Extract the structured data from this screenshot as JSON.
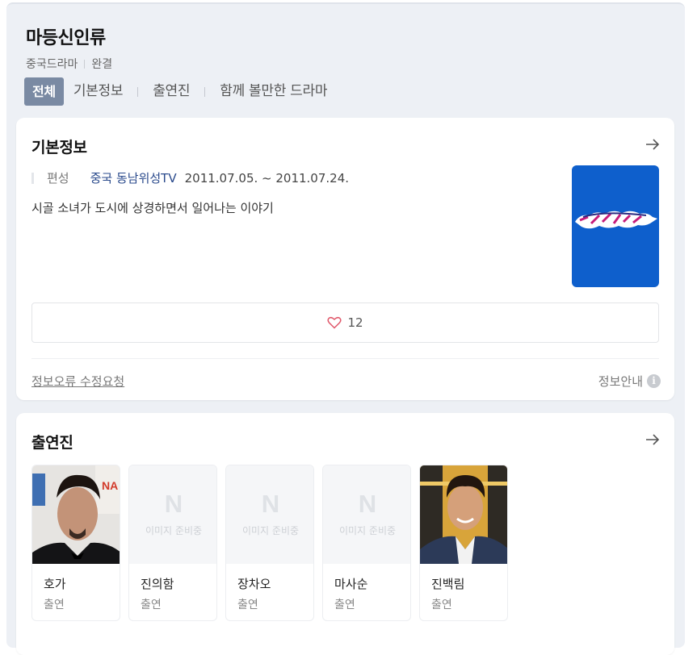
{
  "header": {
    "title": "마등신인류",
    "category": "중국드라마",
    "status": "완결"
  },
  "tabs": [
    {
      "label": "전체",
      "active": true
    },
    {
      "label": "기본정보",
      "active": false
    },
    {
      "label": "출연진",
      "active": false
    },
    {
      "label": "함께 볼만한 드라마",
      "active": false
    }
  ],
  "basic_info": {
    "title": "기본정보",
    "label": "편성",
    "channel": "중국 동남위성TV",
    "date": "2011.07.05. ~ 2011.07.24.",
    "description": "시골 소녀가 도시에 상경하면서 일어나는 이야기",
    "poster_color": "#0e5fcc",
    "like_count": "12",
    "report_link": "정보오류 수정요청",
    "guide": "정보안내",
    "info_icon": "i"
  },
  "cast": {
    "title": "출연진",
    "placeholder_letter": "N",
    "placeholder_text": "이미지 준비중",
    "members": [
      {
        "name": "호가",
        "role": "출연",
        "has_photo": true
      },
      {
        "name": "진의함",
        "role": "출연",
        "has_photo": false
      },
      {
        "name": "장차오",
        "role": "출연",
        "has_photo": false
      },
      {
        "name": "마사순",
        "role": "출연",
        "has_photo": false
      },
      {
        "name": "진백림",
        "role": "출연",
        "has_photo": true
      }
    ]
  },
  "icons": {
    "arrow": "arrow-right-icon",
    "heart": "heart-icon",
    "info": "info-icon"
  }
}
